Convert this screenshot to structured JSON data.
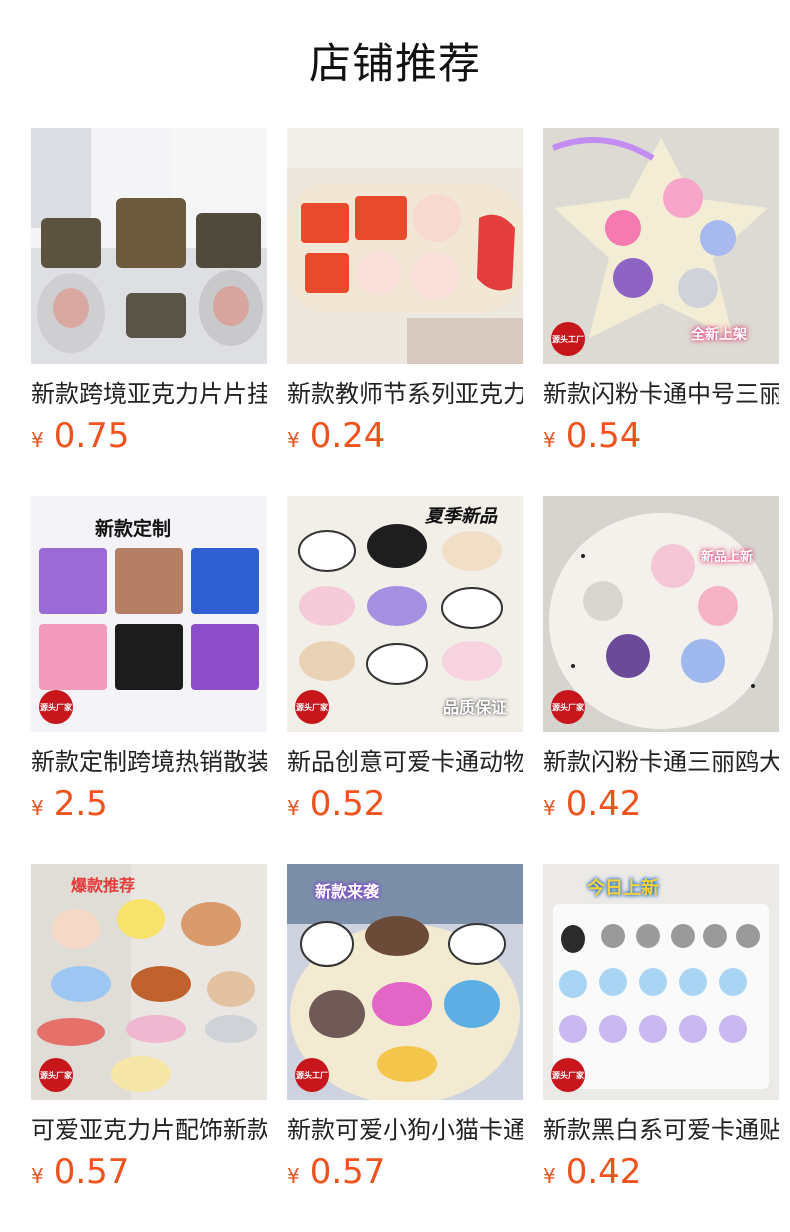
{
  "page": {
    "title": "店铺推荐"
  },
  "products": [
    {
      "title": "新款跨境亚克力片片挂饰",
      "currency": "¥",
      "price": "0.75",
      "overlay": "",
      "badge": ""
    },
    {
      "title": "新款教师节系列亚克力片",
      "currency": "¥",
      "price": "0.24",
      "overlay": "",
      "badge": ""
    },
    {
      "title": "新款闪粉卡通中号三丽鸥",
      "currency": "¥",
      "price": "0.54",
      "overlay": "全新上架",
      "badge": "源头工厂"
    },
    {
      "title": "新款定制跨境热销散装",
      "currency": "¥",
      "price": "2.5",
      "overlay": "新款定制",
      "badge": "源头厂家"
    },
    {
      "title": "新品创意可爱卡通动物",
      "currency": "¥",
      "price": "0.52",
      "overlay": "夏季新品",
      "badge": "源头厂家",
      "overlay2": "品质保证"
    },
    {
      "title": "新款闪粉卡通三丽鸥大号",
      "currency": "¥",
      "price": "0.42",
      "overlay": "新品上新",
      "badge": "源头厂家"
    },
    {
      "title": "可爱亚克力片配饰新款",
      "currency": "¥",
      "price": "0.57",
      "overlay": "爆款推荐",
      "badge": "源头厂家"
    },
    {
      "title": "新款可爱小狗小猫卡通",
      "currency": "¥",
      "price": "0.57",
      "overlay": "新款来袭",
      "badge": "源头工厂"
    },
    {
      "title": "新款黑白系可爱卡通贴",
      "currency": "¥",
      "price": "0.42",
      "overlay": "今日上新",
      "badge": "源头厂家"
    }
  ],
  "colors": {
    "price": "#f0521e",
    "badge": "#c8161d",
    "title": "#222222"
  }
}
